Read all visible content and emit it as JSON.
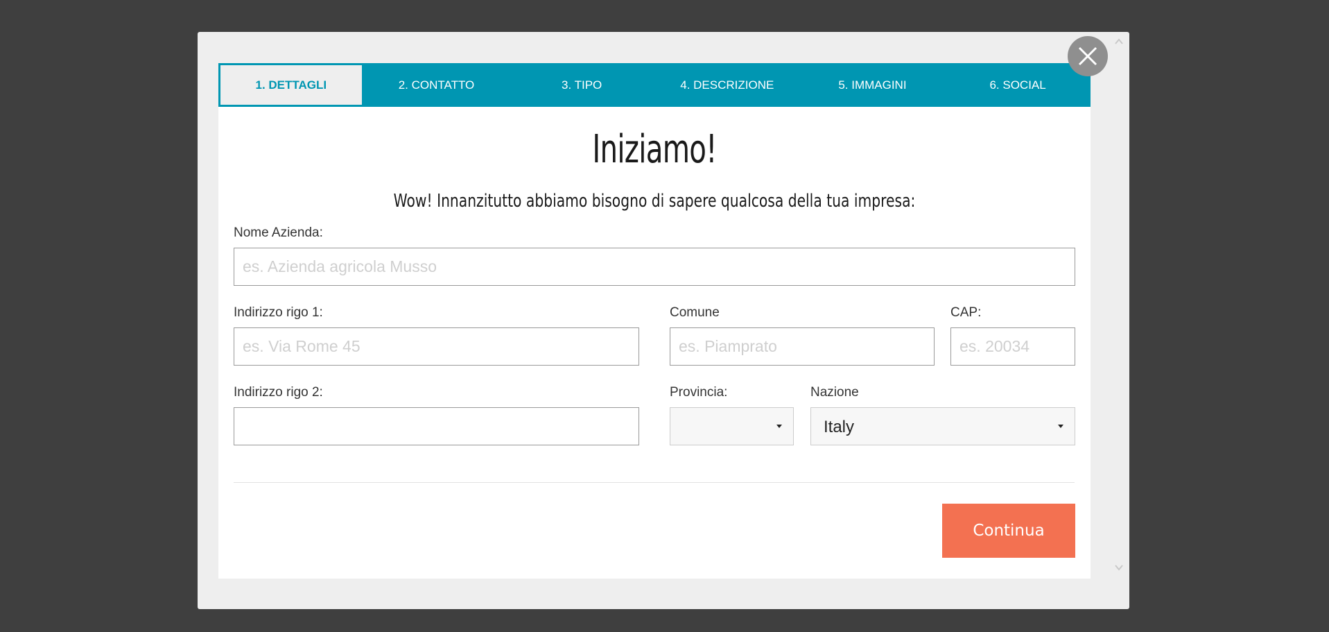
{
  "tabs": [
    {
      "label": "1. DETTAGLI",
      "active": true
    },
    {
      "label": "2. CONTATTO",
      "active": false
    },
    {
      "label": "3. TIPO",
      "active": false
    },
    {
      "label": "4. DESCRIZIONE",
      "active": false
    },
    {
      "label": "5. IMMAGINI",
      "active": false
    },
    {
      "label": "6. SOCIAL",
      "active": false
    }
  ],
  "heading": {
    "title": "Iniziamo!",
    "subtitle": "Wow! Innanzitutto abbiamo bisogno di sapere qualcosa della tua impresa:"
  },
  "form": {
    "company_name": {
      "label": "Nome Azienda:",
      "placeholder": "es. Azienda agricola Musso",
      "value": ""
    },
    "address1": {
      "label": "Indirizzo rigo 1:",
      "placeholder": "es. Via Rome 45",
      "value": ""
    },
    "comune": {
      "label": "Comune",
      "placeholder": "es. Piamprato",
      "value": ""
    },
    "cap": {
      "label": "CAP:",
      "placeholder": "es. 20034",
      "value": ""
    },
    "address2": {
      "label": "Indirizzo rigo 2:",
      "placeholder": "",
      "value": ""
    },
    "provincia": {
      "label": "Provincia:",
      "selected": ""
    },
    "nazione": {
      "label": "Nazione",
      "selected": "Italy"
    }
  },
  "actions": {
    "continue_label": "Continua"
  },
  "icons": {
    "close": "close-icon",
    "scroll_up": "chevron-up-icon",
    "scroll_down": "chevron-down-icon",
    "dropdown": "caret-down-icon"
  },
  "colors": {
    "accent": "#0096b2",
    "button": "#f37151",
    "backdrop": "#3f3f3f",
    "modal": "#eeeeee"
  }
}
